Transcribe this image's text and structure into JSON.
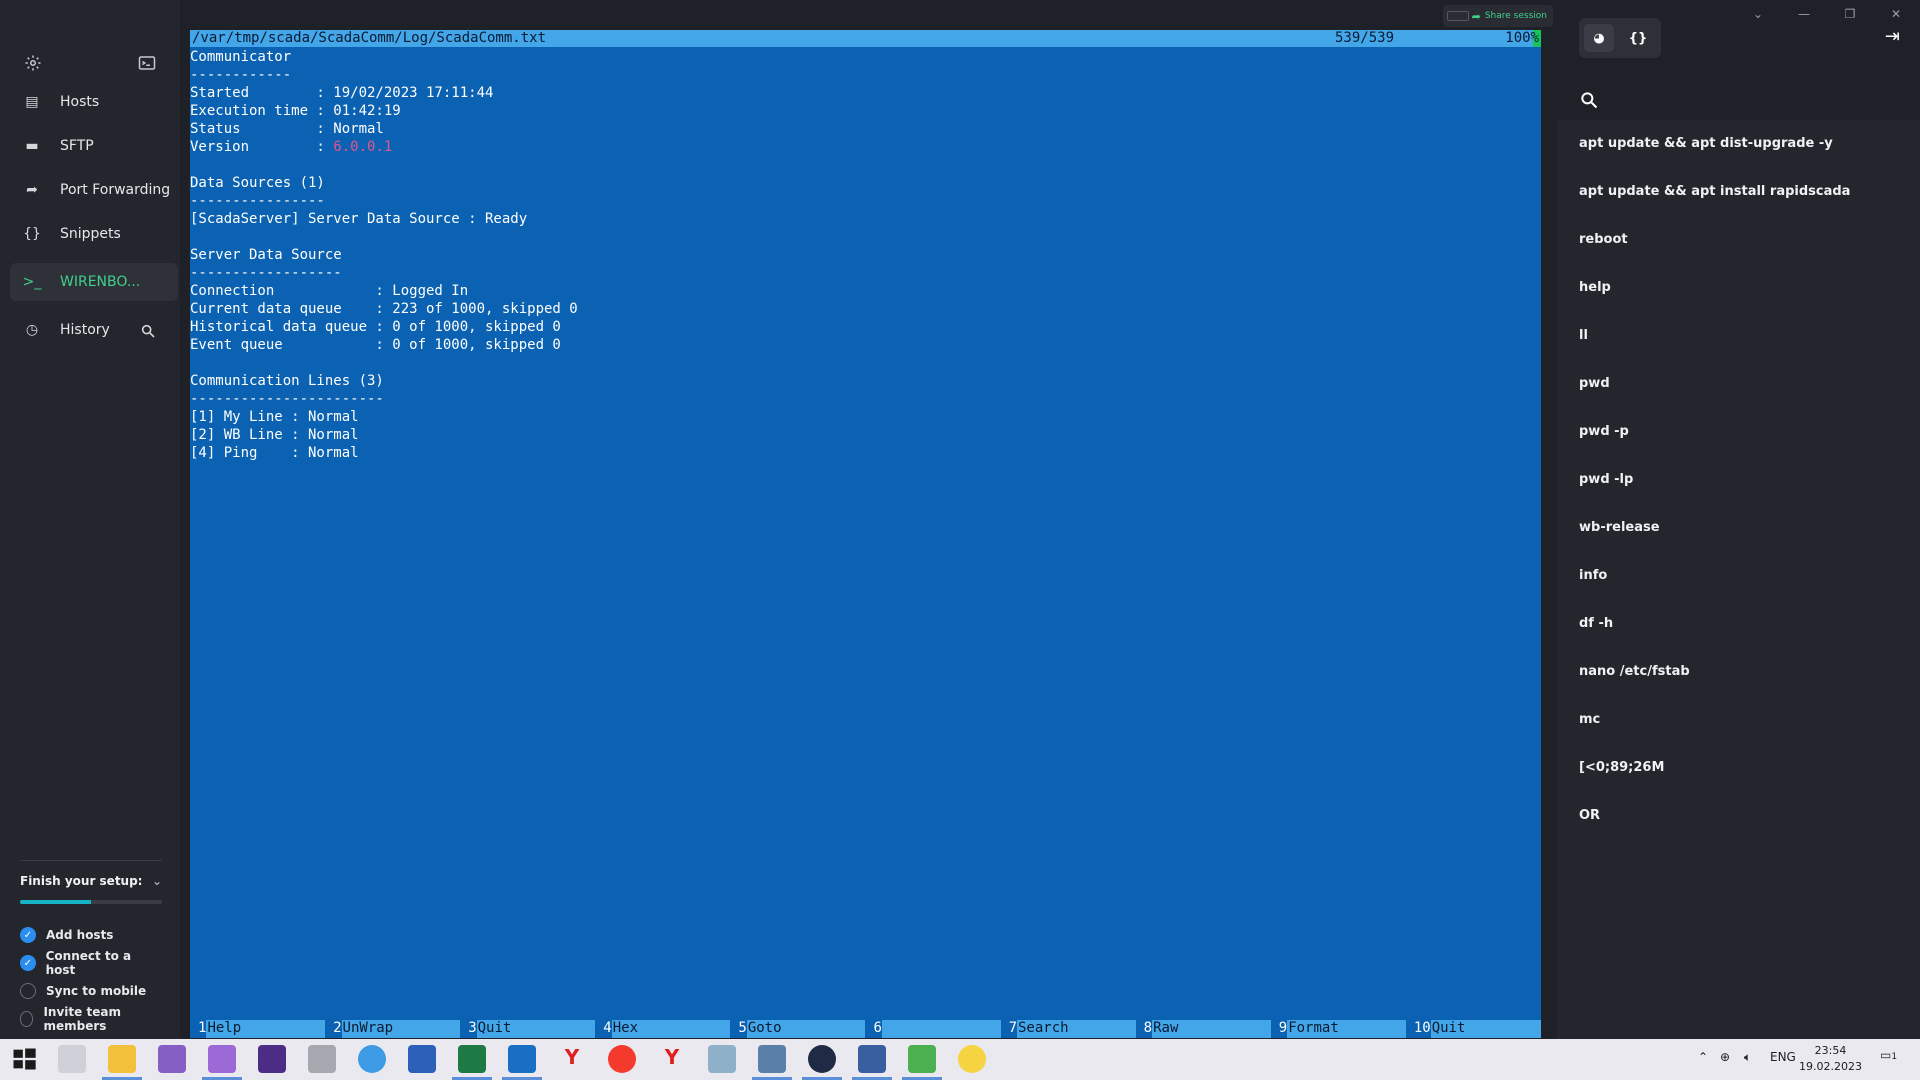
{
  "sidebar": {
    "items": [
      {
        "label": "Hosts",
        "icon": "hosts-icon"
      },
      {
        "label": "SFTP",
        "icon": "folder-icon"
      },
      {
        "label": "Port Forwarding",
        "icon": "forward-icon"
      },
      {
        "label": "Snippets",
        "icon": "braces-icon"
      },
      {
        "label": "WIRENBO...",
        "icon": "terminal-prompt-icon"
      },
      {
        "label": "History",
        "icon": "clock-icon"
      }
    ],
    "active_color": "#3fd08a"
  },
  "setup": {
    "title": "Finish your setup:",
    "progress": 0.5,
    "tasks": [
      {
        "label": "Add hosts",
        "done": true
      },
      {
        "label": "Connect to a host",
        "done": true
      },
      {
        "label": "Sync to mobile",
        "done": false
      },
      {
        "label": "Invite team members",
        "done": false
      }
    ]
  },
  "toolbar": {
    "share_label": "Share session"
  },
  "terminal": {
    "header_path": "/var/tmp/scada/ScadaComm/Log/ScadaComm.txt",
    "header_lines": "539/539",
    "header_pct": "100%",
    "lines": [
      "Communicator",
      "------------",
      "Started        : 19/02/2023 17:11:44",
      "Execution time : 01:42:19",
      "Status         : Normal",
      "Version        : ",
      "",
      "Data Sources (1)",
      "----------------",
      "[ScadaServer] Server Data Source : Ready",
      "",
      "Server Data Source",
      "------------------",
      "Connection            : Logged In",
      "Current data queue    : 223 of 1000, skipped 0",
      "Historical data queue : 0 of 1000, skipped 0",
      "Event queue           : 0 of 1000, skipped 0",
      "",
      "Communication Lines (3)",
      "-----------------------",
      "[1] My Line : Normal",
      "[2] WB Line : Normal",
      "[4] Ping    : Normal"
    ],
    "version_value": "6.0.0.1",
    "fkeys": [
      {
        "num": "1",
        "label": "Help"
      },
      {
        "num": "2",
        "label": "UnWrap"
      },
      {
        "num": "3",
        "label": "Quit"
      },
      {
        "num": "4",
        "label": "Hex"
      },
      {
        "num": "5",
        "label": "Goto"
      },
      {
        "num": "6",
        "label": ""
      },
      {
        "num": "7",
        "label": "Search"
      },
      {
        "num": "8",
        "label": "Raw"
      },
      {
        "num": "9",
        "label": "Format"
      },
      {
        "num": "10",
        "label": "Quit"
      }
    ],
    "bg_color": "#0b62b2",
    "bar_color": "#43a6e8"
  },
  "snippets": {
    "items": [
      "apt update && apt dist-upgrade -y",
      "apt update && apt install rapidscada",
      "reboot",
      "help",
      "ll",
      "pwd",
      "pwd -p",
      "pwd -lp",
      "wb-release",
      "info",
      "df -h",
      "nano /etc/fstab",
      "mc",
      "[<0;89;26M",
      "OR"
    ]
  },
  "taskbar": {
    "lang": "ENG",
    "time": "23:54",
    "date": "19.02.2023",
    "notifications": "1"
  }
}
